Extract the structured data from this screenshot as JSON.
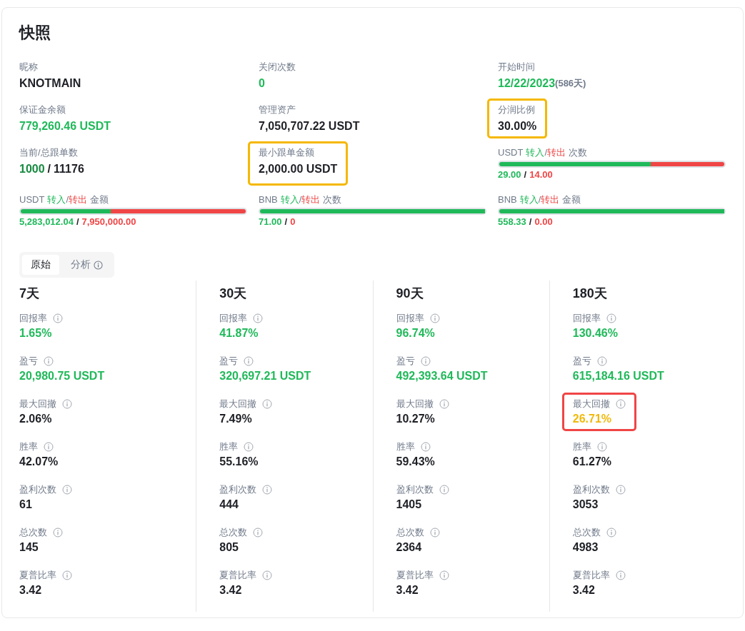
{
  "title": "快照",
  "overview": [
    {
      "kind": "text",
      "label": "昵称",
      "value": "KNOTMAIN",
      "color": "#1e2026"
    },
    {
      "kind": "text",
      "label": "关闭次数",
      "value": "0",
      "color": "#20b95a"
    },
    {
      "kind": "date",
      "label": "开始时间",
      "value": "12/22/2023",
      "suffix": "(586天)"
    },
    {
      "kind": "text",
      "label": "保证金余额",
      "value": "779,260.46 USDT",
      "color": "#20b95a"
    },
    {
      "kind": "text",
      "label": "管理资产",
      "value": "7,050,707.22 USDT",
      "color": "#1e2026"
    },
    {
      "kind": "text",
      "label": "分润比例",
      "value": "30.00%",
      "color": "#1e2026",
      "highlight": {
        "color": "#f5b800"
      }
    },
    {
      "kind": "ratio",
      "label": "当前/总跟单数",
      "current": "1000",
      "separator": "/",
      "total": "11176"
    },
    {
      "kind": "text",
      "label": "最小跟单金额",
      "value": "2,000.00 USDT",
      "color": "#1e2026",
      "highlight": {
        "color": "#f5b800"
      }
    },
    {
      "kind": "flow",
      "asset": "USDT",
      "in_label": "转入",
      "slash": "/",
      "out_label": "转出",
      "metric": "次数",
      "level": 0.674,
      "in_value": "29.00",
      "separator": "/",
      "out_value": "14.00"
    },
    {
      "kind": "flow",
      "asset": "USDT",
      "in_label": "转入",
      "slash": "/",
      "out_label": "转出",
      "metric": "金额",
      "level": 0.399,
      "in_value": "5,283,012.04",
      "separator": "/",
      "out_value": "7,950,000.00"
    },
    {
      "kind": "flow",
      "asset": "BNB",
      "in_label": "转入",
      "slash": "/",
      "out_label": "转出",
      "metric": "次数",
      "level": 1,
      "in_value": "71.00",
      "separator": "/",
      "out_value": "0"
    },
    {
      "kind": "flow",
      "asset": "BNB",
      "in_label": "转入",
      "slash": "/",
      "out_label": "转出",
      "metric": "金额",
      "level": 1,
      "in_value": "558.33",
      "separator": "/",
      "out_value": "0.00"
    }
  ],
  "tabs": [
    {
      "label": "原始",
      "selected": true,
      "info": false
    },
    {
      "label": "分析",
      "selected": false,
      "info": true
    }
  ],
  "periods": [
    {
      "title": "7天",
      "metrics": [
        {
          "label": "回报率",
          "value": "1.65%",
          "color": "#20b95a"
        },
        {
          "label": "盈亏",
          "value": "20,980.75 USDT",
          "color": "#20b95a"
        },
        {
          "label": "最大回撤",
          "value": "2.06%",
          "color": "#1e2026"
        },
        {
          "label": "胜率",
          "value": "42.07%",
          "color": "#1e2026"
        },
        {
          "label": "盈利次数",
          "value": "61",
          "color": "#1e2026"
        },
        {
          "label": "总次数",
          "value": "145",
          "color": "#1e2026"
        },
        {
          "label": "夏普比率",
          "value": "3.42",
          "color": "#1e2026"
        }
      ]
    },
    {
      "title": "30天",
      "metrics": [
        {
          "label": "回报率",
          "value": "41.87%",
          "color": "#20b95a"
        },
        {
          "label": "盈亏",
          "value": "320,697.21 USDT",
          "color": "#20b95a"
        },
        {
          "label": "最大回撤",
          "value": "7.49%",
          "color": "#1e2026"
        },
        {
          "label": "胜率",
          "value": "55.16%",
          "color": "#1e2026"
        },
        {
          "label": "盈利次数",
          "value": "444",
          "color": "#1e2026"
        },
        {
          "label": "总次数",
          "value": "805",
          "color": "#1e2026"
        },
        {
          "label": "夏普比率",
          "value": "3.42",
          "color": "#1e2026"
        }
      ]
    },
    {
      "title": "90天",
      "metrics": [
        {
          "label": "回报率",
          "value": "96.74%",
          "color": "#20b95a"
        },
        {
          "label": "盈亏",
          "value": "492,393.64 USDT",
          "color": "#20b95a"
        },
        {
          "label": "最大回撤",
          "value": "10.27%",
          "color": "#1e2026"
        },
        {
          "label": "胜率",
          "value": "59.43%",
          "color": "#1e2026"
        },
        {
          "label": "盈利次数",
          "value": "1405",
          "color": "#1e2026"
        },
        {
          "label": "总次数",
          "value": "2364",
          "color": "#1e2026"
        },
        {
          "label": "夏普比率",
          "value": "3.42",
          "color": "#1e2026"
        }
      ]
    },
    {
      "title": "180天",
      "metrics": [
        {
          "label": "回报率",
          "value": "130.46%",
          "color": "#20b95a"
        },
        {
          "label": "盈亏",
          "value": "615,184.16 USDT",
          "color": "#20b95a"
        },
        {
          "label": "最大回撤",
          "value": "26.71%",
          "color": "#f0b90b",
          "highlight": {
            "color": "#f04545"
          }
        },
        {
          "label": "胜率",
          "value": "61.27%",
          "color": "#1e2026"
        },
        {
          "label": "盈利次数",
          "value": "3053",
          "color": "#1e2026"
        },
        {
          "label": "总次数",
          "value": "4983",
          "color": "#1e2026"
        },
        {
          "label": "夏普比率",
          "value": "3.42",
          "color": "#1e2026"
        }
      ]
    }
  ]
}
